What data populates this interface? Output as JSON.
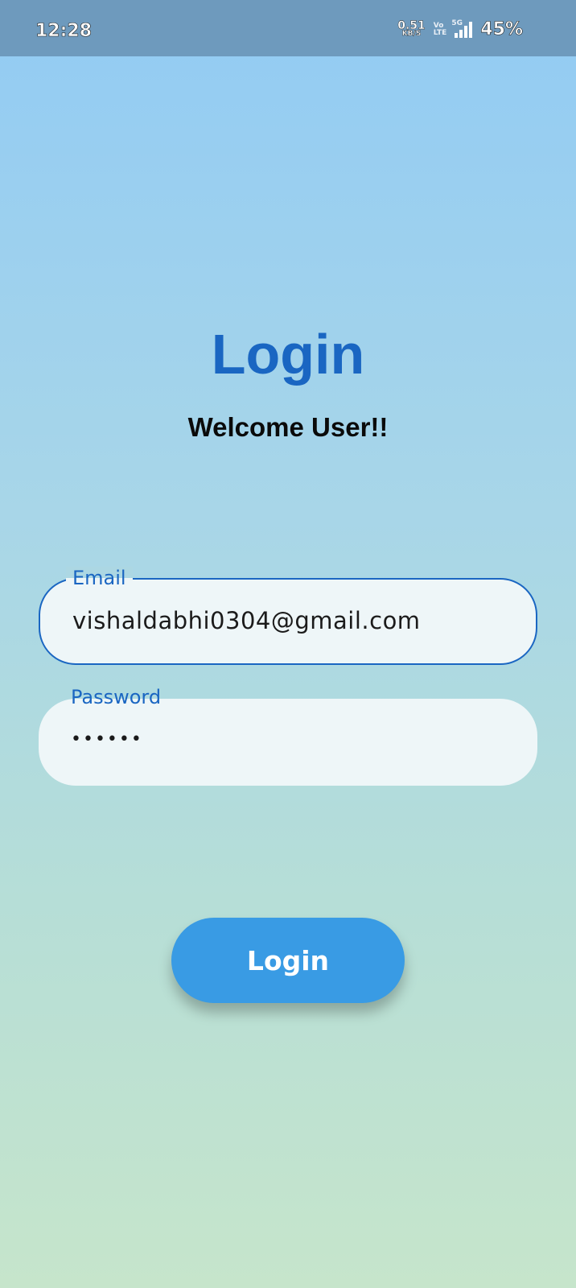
{
  "status_bar": {
    "time": "12:28",
    "net_speed_value": "0.51",
    "net_speed_unit": "KB/S",
    "volte_top": "Vo",
    "volte_bottom": "LTE",
    "network_type": "5G",
    "battery": "45%",
    "icons": [
      "volte-icon",
      "signal-icon"
    ]
  },
  "header": {
    "title": "Login",
    "subtitle": "Welcome User!!"
  },
  "form": {
    "email": {
      "label": "Email",
      "value": "vishaldabhi0304@gmail.com"
    },
    "password": {
      "label": "Password",
      "masked_value": "••••••"
    },
    "submit_label": "Login"
  },
  "colors": {
    "accent": "#1a66c2",
    "button": "#399be4",
    "status_bar": "#6e9abd"
  }
}
